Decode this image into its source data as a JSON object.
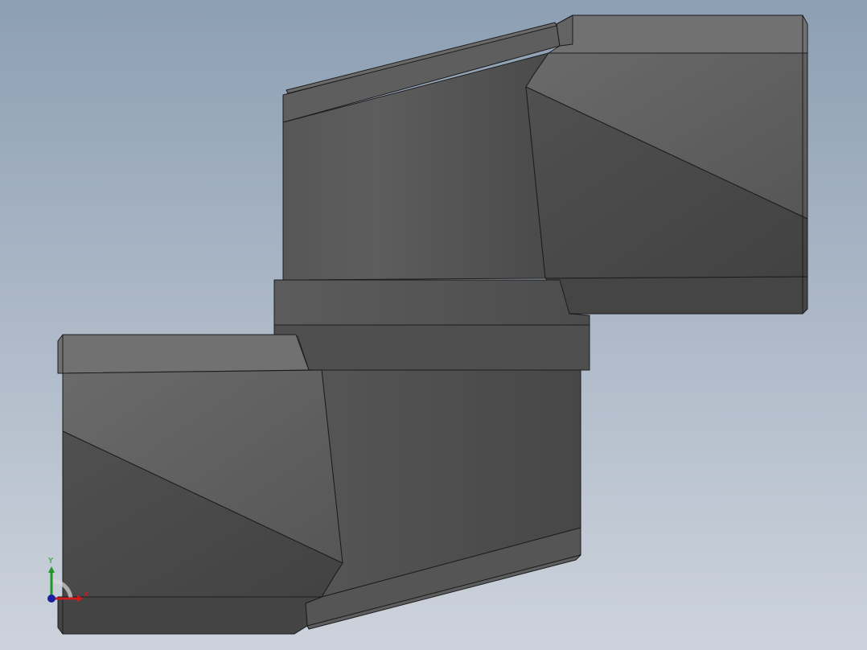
{
  "viewport": {
    "background_top": "#8d9fb4",
    "background_bottom": "#cdd3dc"
  },
  "model": {
    "face_light": "#6f6f6f",
    "face_mid": "#5a5a5a",
    "face_dark": "#444444",
    "edge_color": "#1c1c1c"
  },
  "triad": {
    "x_label": "X",
    "y_label": "Y",
    "x_color": "#c81e1e",
    "y_color": "#1e9628",
    "z_color": "#1e1ea0"
  }
}
